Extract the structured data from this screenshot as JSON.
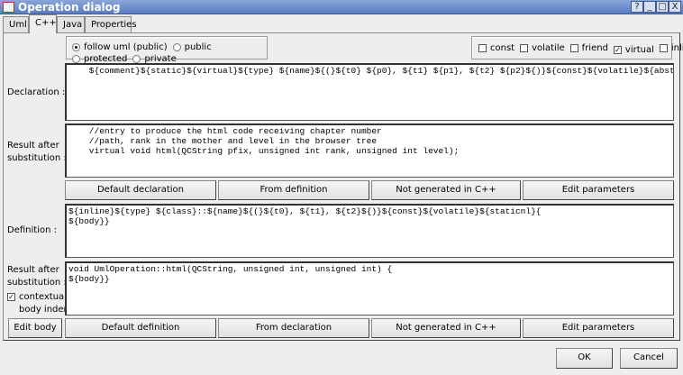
{
  "window": {
    "title": "Operation dialog",
    "buttons": [
      "?",
      "_",
      "□",
      "X"
    ]
  },
  "tabs": [
    {
      "label": "Uml"
    },
    {
      "label": "C++"
    },
    {
      "label": "Java"
    },
    {
      "label": "Properties"
    }
  ],
  "visibility": {
    "options": [
      {
        "label": "follow uml (public)",
        "checked": true
      },
      {
        "label": "public",
        "checked": false
      },
      {
        "label": "protected",
        "checked": false
      },
      {
        "label": "private",
        "checked": false
      }
    ]
  },
  "modifiers": [
    {
      "label": "const",
      "checked": false
    },
    {
      "label": "volatile",
      "checked": false
    },
    {
      "label": "friend",
      "checked": false
    },
    {
      "label": "virtual",
      "checked": true
    },
    {
      "label": "inline",
      "checked": false
    }
  ],
  "declaration": {
    "label": "Declaration :",
    "value": "    ${comment}${static}${virtual}${type} ${name}${(}${t0} ${p0}, ${t1} ${p1}, ${t2} ${p2}${)}${const}${volatile}${abstract};"
  },
  "decl_result": {
    "label1": "Result after",
    "label2": "substitution :",
    "value": "    //entry to produce the html code receiving chapter number\n    //path, rank in the mother and level in the browser tree\n    virtual void html(QCString pfix, unsigned int rank, unsigned int level);"
  },
  "decl_buttons": [
    "Default declaration",
    "From definition",
    "Not generated in C++",
    "Edit parameters"
  ],
  "definition": {
    "label": "Definition :",
    "value": "${inline}${type} ${class}::${name}${(}${t0}, ${t1}, ${t2}${)}${const}${volatile}${staticnl}{\n${body}}"
  },
  "def_result": {
    "label1": "Result after",
    "label2": "substitution :",
    "value": "void UmlOperation::html(QCString, unsigned int, unsigned int) {\n${body}}",
    "indent_label1": "contextual",
    "indent_label2": "body indent",
    "indent_checked": true
  },
  "def_buttons": [
    "Edit body",
    "Default definition",
    "From declaration",
    "Not generated in C++",
    "Edit parameters"
  ],
  "footer": {
    "ok": "OK",
    "cancel": "Cancel"
  }
}
